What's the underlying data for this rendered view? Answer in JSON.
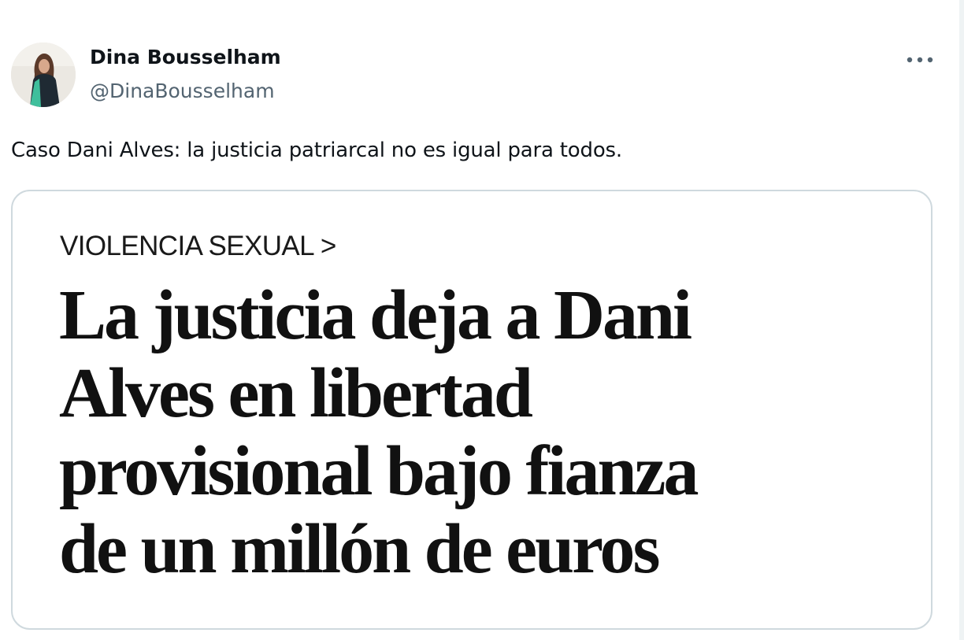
{
  "tweet": {
    "author": {
      "name": "Dina Bousselham",
      "handle": "@DinaBousselham",
      "avatar_icon": "profile-photo"
    },
    "more_icon": "more-options-icon",
    "text": "Caso Dani Alves: la justicia patriarcal no es igual para todos.",
    "media": {
      "kicker": "VIOLENCIA SEXUAL >",
      "headline_lines": [
        "La justicia deja a Dani",
        "Alves en libertad",
        "provisional bajo fianza",
        "de un millón de euros"
      ]
    }
  },
  "colors": {
    "text_primary": "#0f1419",
    "text_secondary": "#536471",
    "card_border": "#cfd9de",
    "headline": "#111111"
  }
}
